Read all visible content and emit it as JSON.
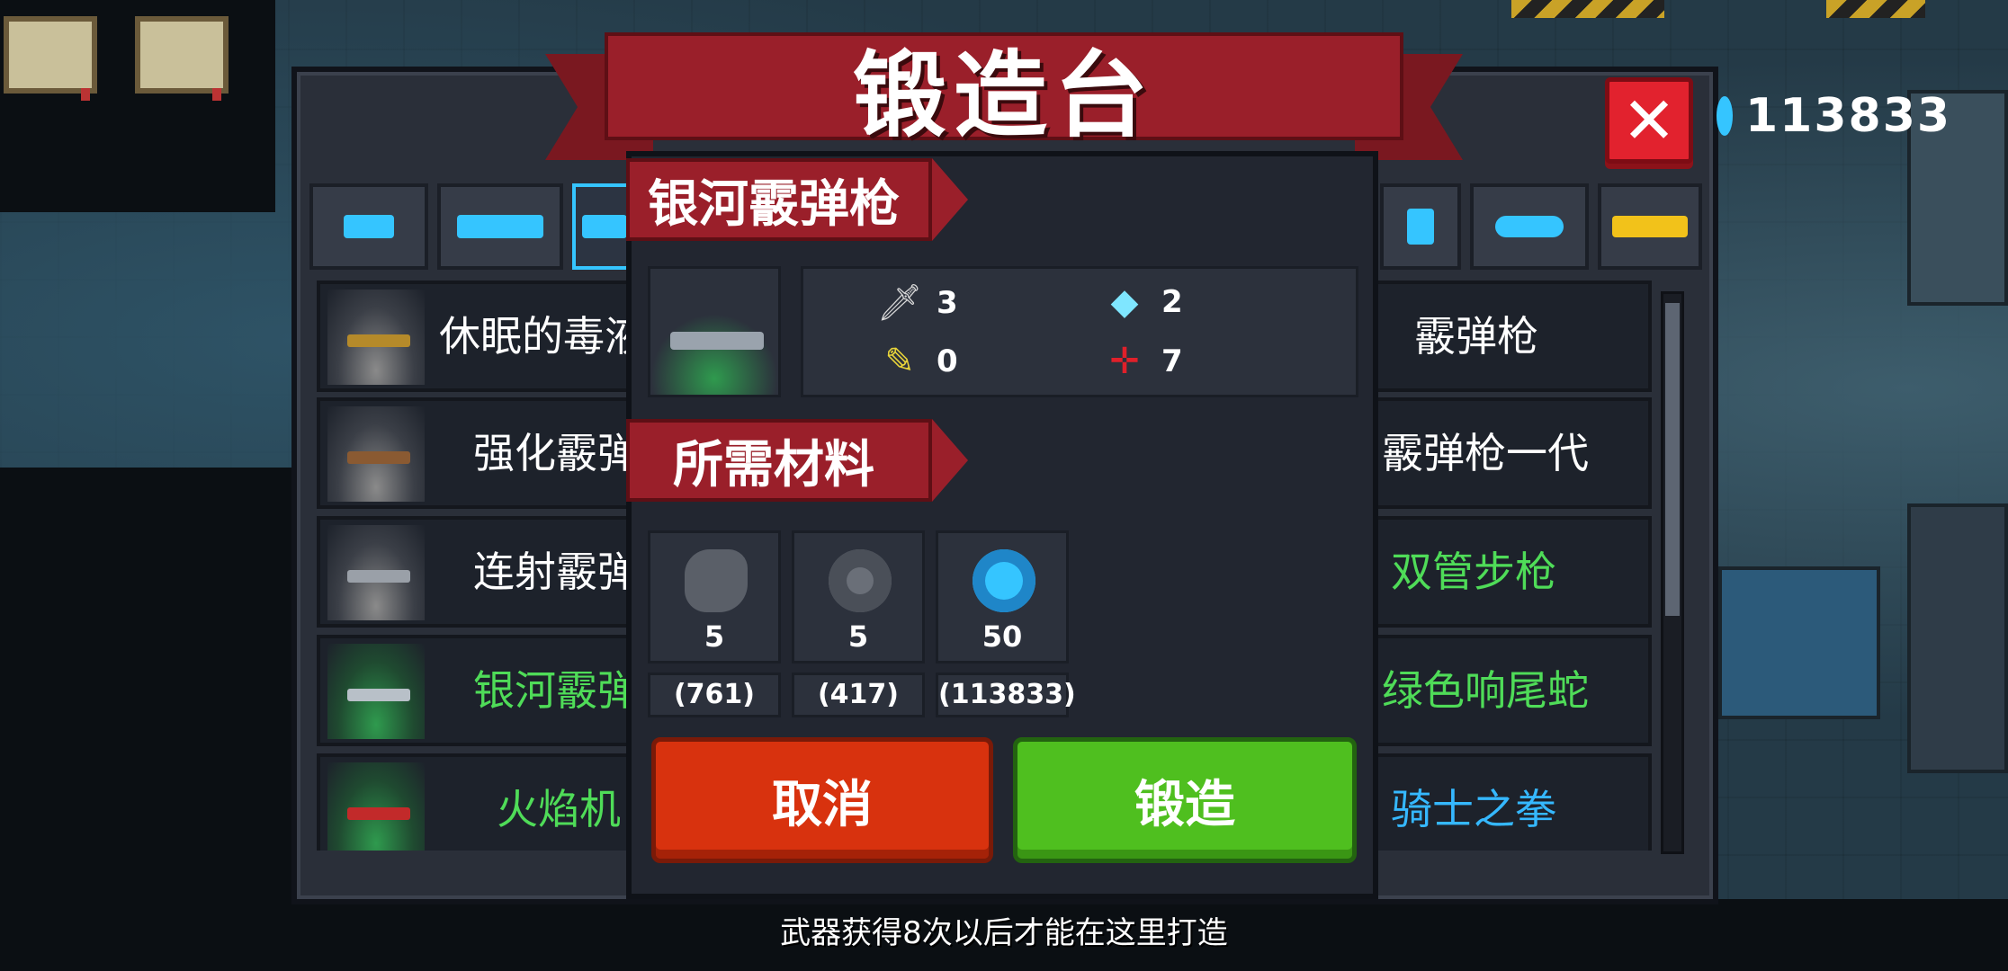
{
  "window": {
    "title": "锻造台"
  },
  "currency": {
    "icon": "gem-icon",
    "value": "113833"
  },
  "close": {
    "label": "✕"
  },
  "tabs": [
    {
      "icon": "pistol-icon",
      "color": "#35c5ff"
    },
    {
      "icon": "rifle-icon",
      "color": "#35c5ff"
    },
    {
      "icon": "shotgun-icon",
      "color": "#35c5ff",
      "active": true
    },
    {
      "icon": "bow-icon",
      "color": "#35c5ff"
    },
    {
      "icon": "fish-icon",
      "color": "#35c5ff"
    },
    {
      "icon": "crown-icon",
      "color": "#f2c21a"
    }
  ],
  "list_left": [
    {
      "label": "休眠的毒液",
      "color": "#ffffff",
      "thumb": "gold-shotgun",
      "green": false
    },
    {
      "label": "强化霰弹",
      "color": "#ffffff",
      "thumb": "brown-shotgun",
      "green": false
    },
    {
      "label": "连射霰弹",
      "color": "#ffffff",
      "thumb": "gray-shotgun",
      "green": false
    },
    {
      "label": "银河霰弹",
      "color": "#4fdc58",
      "thumb": "galaxy-shotgun",
      "green": true
    },
    {
      "label": "火焰机",
      "color": "#4fdc58",
      "thumb": "flame-gun",
      "green": true
    }
  ],
  "list_right": [
    {
      "label": "霰弹枪",
      "color": "#ffffff"
    },
    {
      "label": "霰弹枪一代",
      "color": "#ffffff"
    },
    {
      "label": "双管步枪",
      "color": "#4fdc58"
    },
    {
      "label": "绿色响尾蛇",
      "color": "#4fdc58"
    },
    {
      "label": "骑士之拳",
      "color": "#35b8ff"
    }
  ],
  "detail": {
    "name": "银河霰弹枪",
    "stats": [
      {
        "icon": "sword-icon",
        "glyph": "🗡",
        "value": "3"
      },
      {
        "icon": "diamond-icon",
        "glyph": "◆",
        "value": "2"
      },
      {
        "icon": "feather-icon",
        "glyph": "✎",
        "value": "0"
      },
      {
        "icon": "crosshair-icon",
        "glyph": "✛",
        "value": "7"
      }
    ],
    "materials_title": "所需材料",
    "materials": [
      {
        "icon": "ore-icon",
        "qty": "5",
        "owned": "(761)"
      },
      {
        "icon": "gear-icon",
        "qty": "5",
        "owned": "(417)"
      },
      {
        "icon": "gem-icon",
        "qty": "50",
        "owned": "(113833)"
      }
    ],
    "cancel_label": "取消",
    "forge_label": "锻造"
  },
  "hint": "武器获得8次以后才能在这里打造"
}
